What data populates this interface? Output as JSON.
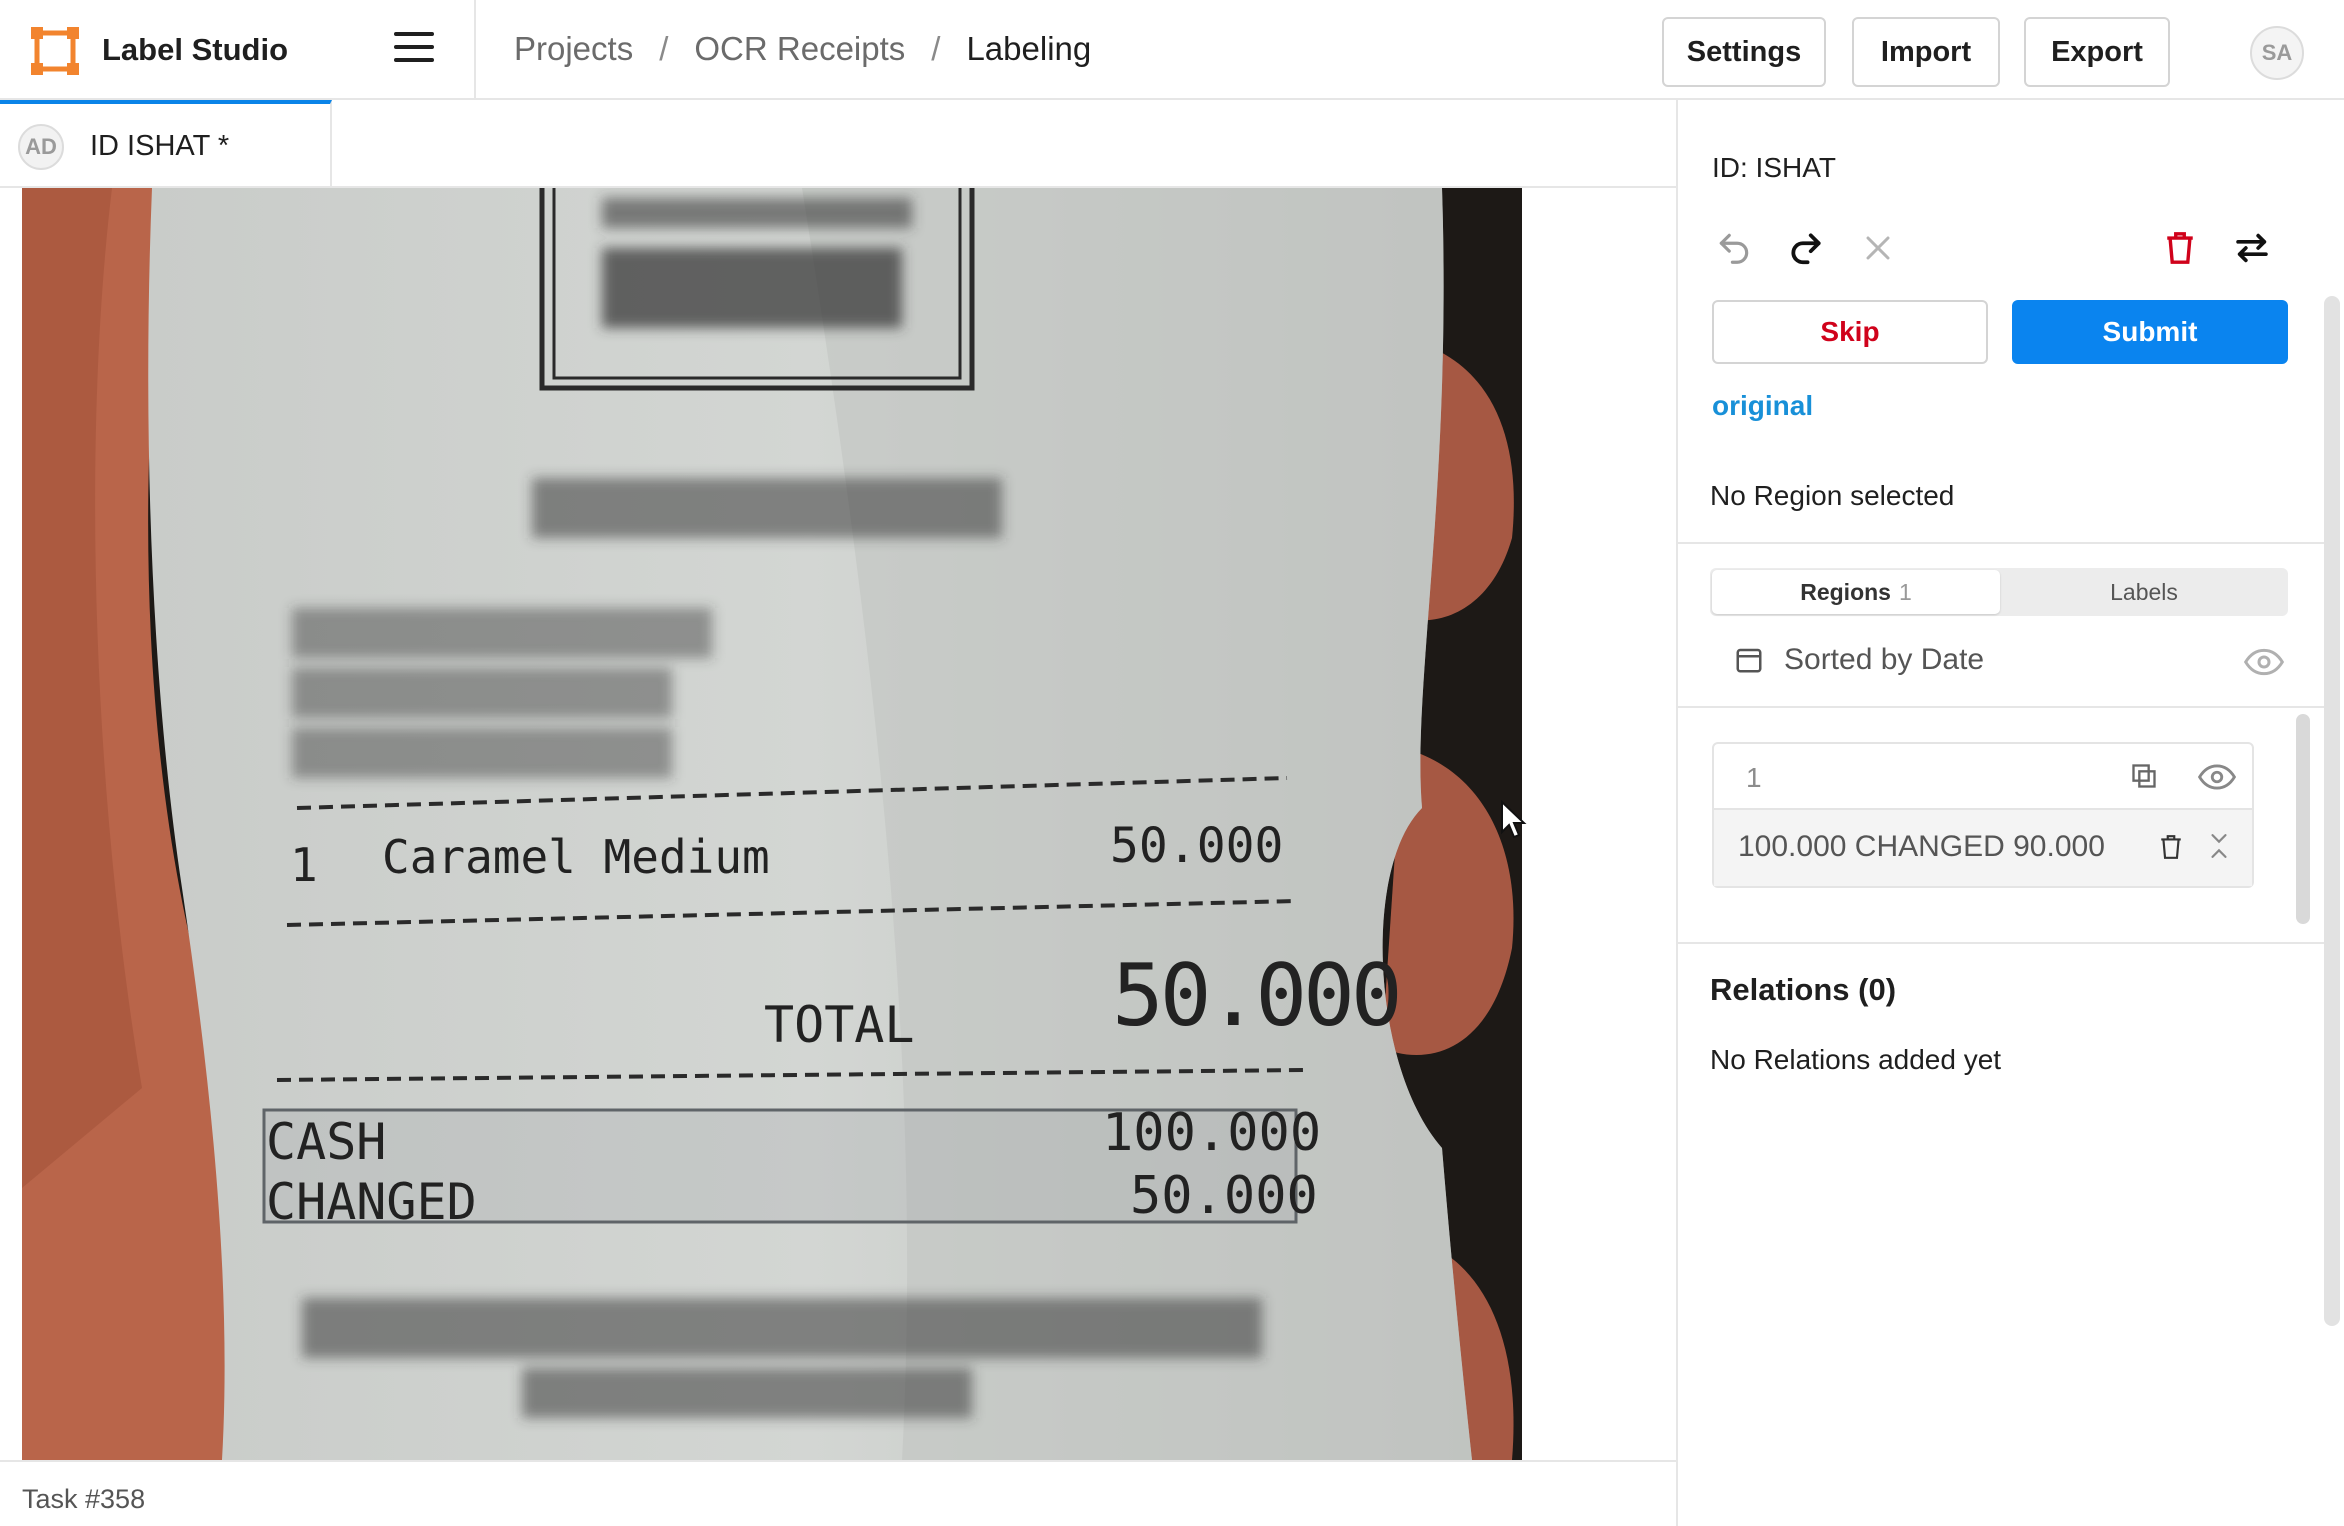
{
  "app": {
    "title": "Label Studio"
  },
  "breadcrumb": {
    "items": [
      "Projects",
      "OCR Receipts",
      "Labeling"
    ],
    "separator": "/"
  },
  "header_buttons": {
    "settings": "Settings",
    "import": "Import",
    "export": "Export"
  },
  "user": {
    "initials": "SA"
  },
  "tab": {
    "avatar": "AD",
    "label": "ID ISHAT *"
  },
  "receipt": {
    "item_qty": "1",
    "item_name": "Caramel Medium",
    "item_price": "50.000",
    "total_label": "TOTAL",
    "total_value": "50.000",
    "cash_label": "CASH",
    "cash_value": "100.000",
    "changed_label": "CHANGED",
    "changed_value": "50.000"
  },
  "status": {
    "task": "Task #358"
  },
  "panel": {
    "task_id": "ID: ISHAT",
    "skip": "Skip",
    "submit": "Submit",
    "original_link": "original",
    "no_region": "No Region selected",
    "tabs": {
      "regions": "Regions",
      "regions_count": "1",
      "labels": "Labels"
    },
    "sort_label": "Sorted by Date",
    "regions": [
      {
        "index": "1",
        "text": "100.000  CHANGED 90.000"
      }
    ],
    "relations_title": "Relations (0)",
    "relations_empty": "No Relations added yet"
  },
  "icons": {
    "logo": "label-studio-logo-icon",
    "menu": "hamburger-menu-icon",
    "undo": "undo-icon",
    "redo": "redo-icon",
    "reset": "close-icon",
    "delete": "trash-icon",
    "settings": "swap-arrows-icon",
    "sort": "calendar-icon",
    "visibility": "eye-icon",
    "copy": "duplicate-icon"
  },
  "colors": {
    "accent": "#0a84ef",
    "danger": "#d0021b",
    "link": "#1890d8",
    "logo": "#f2842e"
  }
}
